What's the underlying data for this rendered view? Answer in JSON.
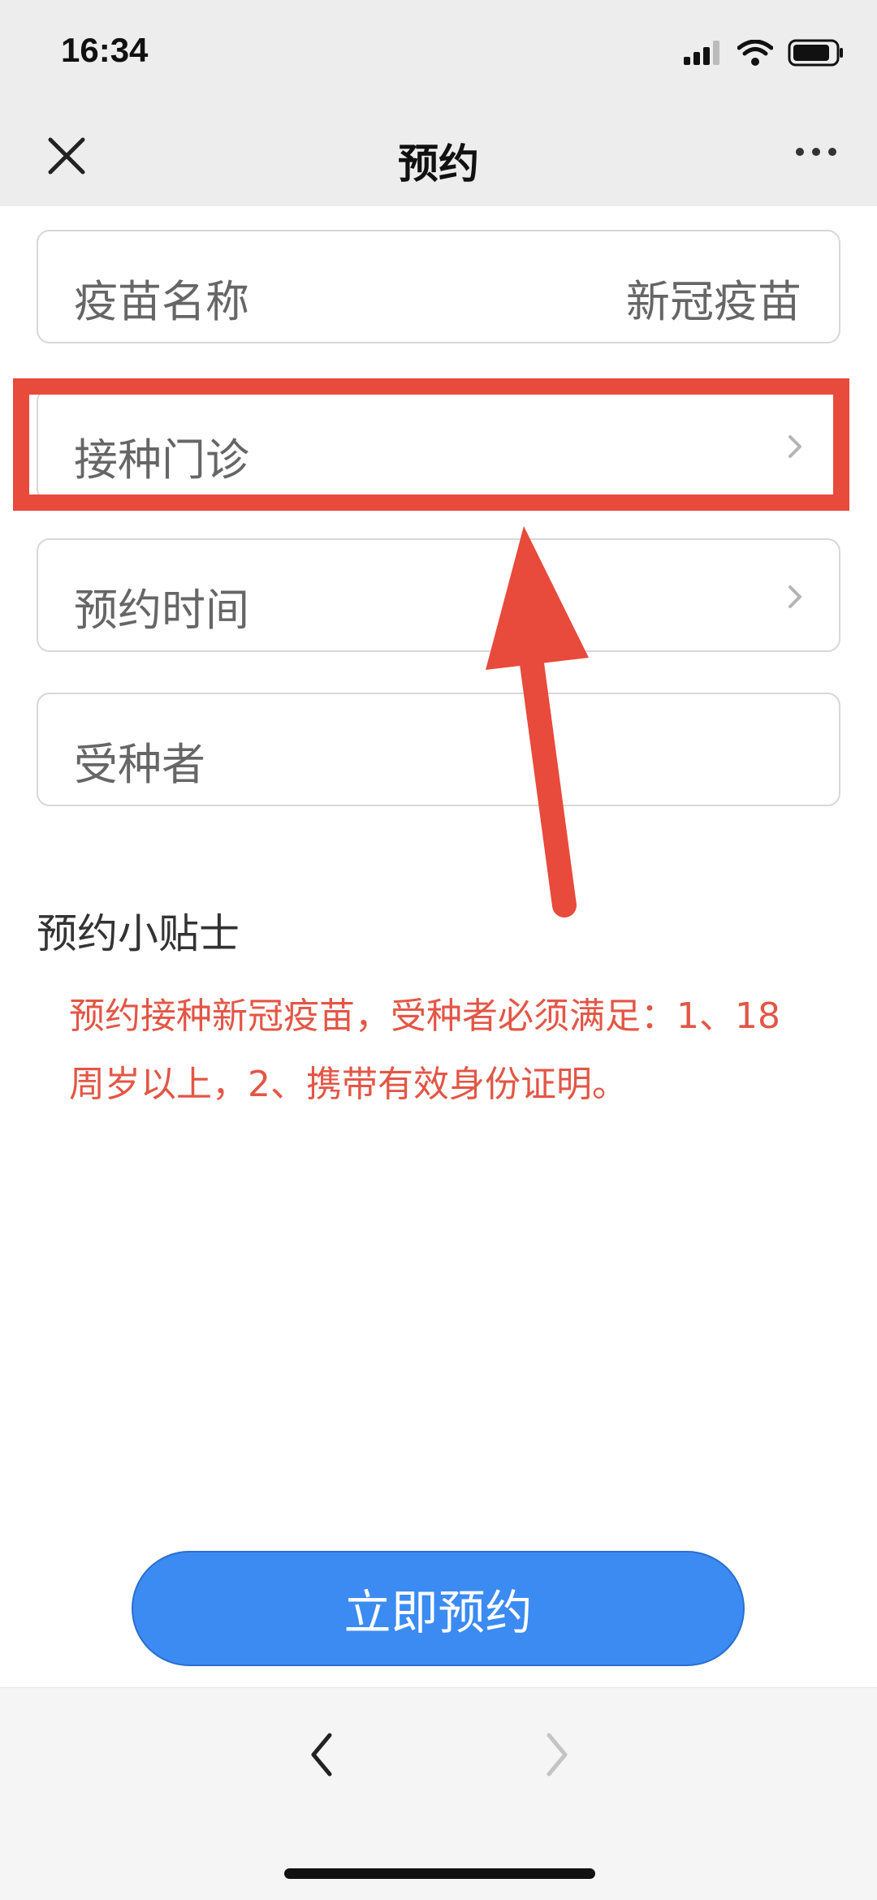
{
  "status": {
    "time": "16:34"
  },
  "nav": {
    "title": "预约"
  },
  "fields": [
    {
      "label": "疫苗名称",
      "value": "新冠疫苗"
    },
    {
      "label": "接种门诊"
    },
    {
      "label": "预约时间"
    },
    {
      "label": "受种者"
    }
  ],
  "tips": {
    "title": "预约小贴士",
    "text": "预约接种新冠疫苗，受种者必须满足：1、18周岁以上，2、携带有效身份证明。"
  },
  "submit": {
    "label": "立即预约"
  },
  "annotation": {
    "color": "#e84a3c"
  },
  "colors": {
    "accent": "#3b8bf2",
    "tip_text": "#e35646"
  },
  "icons": [
    "close-icon",
    "more-icon",
    "chevron-right-icon",
    "back-arrow-icon",
    "forward-arrow-icon",
    "signal-icon",
    "wifi-icon",
    "battery-icon"
  ]
}
